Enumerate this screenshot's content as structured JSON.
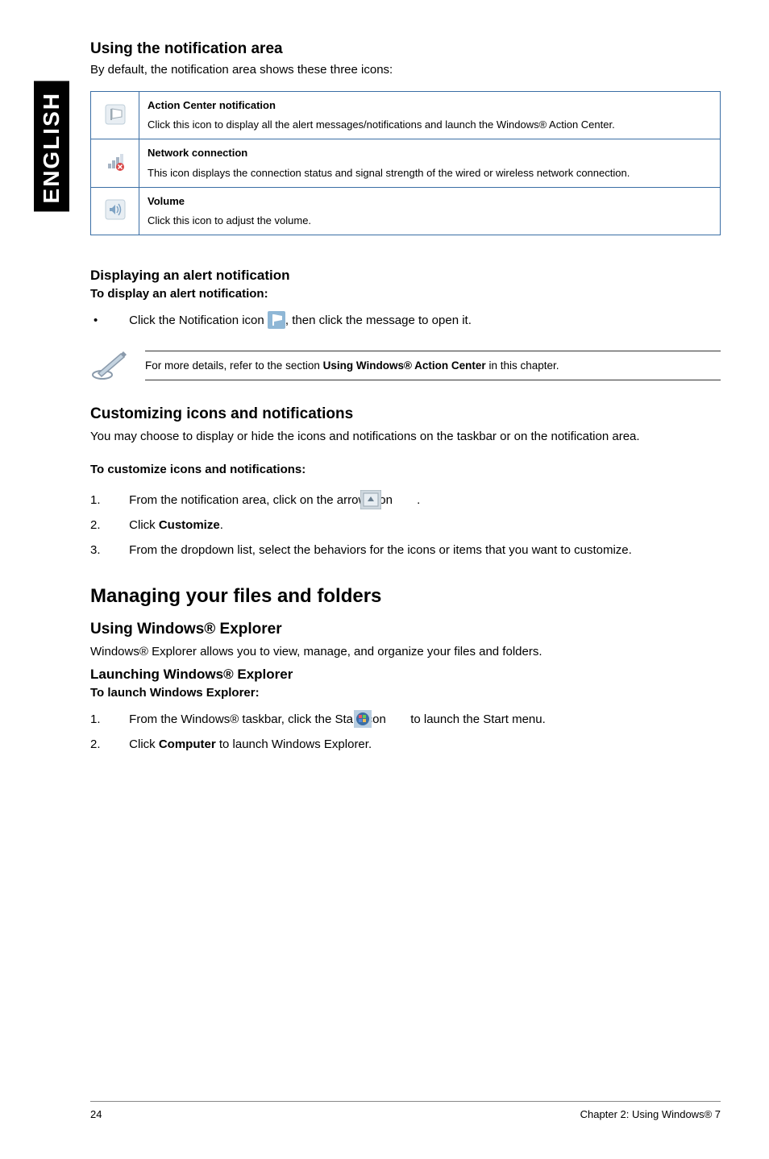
{
  "sideTab": "ENGLISH",
  "headings": {
    "notificationArea": "Using the notification area",
    "displayAlert": "Displaying an alert notification",
    "customize": "Customizing icons and notifications",
    "manageFiles": "Managing your files and folders",
    "usingExplorer": "Using Windows® Explorer",
    "launchExplorer": "Launching Windows® Explorer"
  },
  "intro": {
    "notificationArea": "By default, the notification area shows these three icons:",
    "customize": "You may choose to display or hide the icons and notifications on the taskbar or on the notification area.",
    "explorer": "Windows® Explorer allows you to view, manage, and organize your files and folders."
  },
  "boldLines": {
    "toDisplayAlert": "To display an alert notification:",
    "toCustomize": "To customize icons and notifications:",
    "toLaunchExplorer": "To launch Windows Explorer:"
  },
  "table": [
    {
      "title": "Action Center notification",
      "desc": "Click this icon to display all the alert messages/notifications and launch the Windows® Action Center."
    },
    {
      "title": "Network connection",
      "desc": "This icon displays the connection status and signal strength of the wired or wireless network connection."
    },
    {
      "title": "Volume",
      "desc": "Click this icon to adjust the volume."
    }
  ],
  "bullet": {
    "clickNotificationPart1": "Click the Notification icon ",
    "clickNotificationPart2": ", then click the message to open it."
  },
  "note": {
    "text1": "For more details, refer to the section ",
    "bold": "Using Windows® Action Center",
    "text2": " in this chapter."
  },
  "customizeSteps": {
    "step1": "From the notification area, click on the arrow icon ",
    "step1end": ".",
    "step2a": "Click ",
    "step2b": "Customize",
    "step2c": ".",
    "step3": "From the dropdown list, select the behaviors for the icons or items that you want to customize."
  },
  "explorerSteps": {
    "step1a": "From the Windows® taskbar, click the Start icon ",
    "step1b": " to launch the Start menu.",
    "step2a": "Click ",
    "step2b": "Computer",
    "step2c": " to launch Windows Explorer."
  },
  "footer": {
    "pageNum": "24",
    "chapter": "Chapter 2: Using Windows® 7"
  }
}
